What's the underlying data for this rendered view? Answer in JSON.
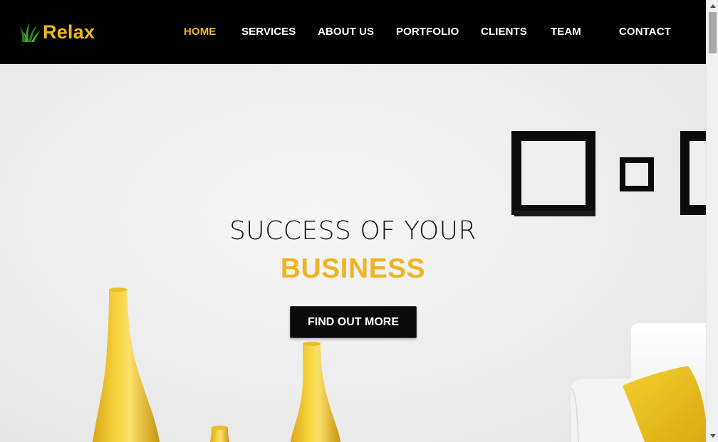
{
  "brand": {
    "name": "Relax",
    "icon": "grass-icon",
    "accent_color": "#f2b821"
  },
  "nav": {
    "items": [
      {
        "label": "HOME",
        "active": true
      },
      {
        "label": "SERVICES",
        "active": false
      },
      {
        "label": "ABOUT US",
        "active": false
      },
      {
        "label": "PORTFOLIO",
        "active": false
      },
      {
        "label": "CLIENTS",
        "active": false
      },
      {
        "label": "TEAM",
        "active": false
      },
      {
        "label": "CONTACT",
        "active": false
      }
    ]
  },
  "hero": {
    "title": "SUCCESS OF YOUR",
    "subtitle": "BUSINESS",
    "cta_label": "FIND OUT MORE",
    "highlight_color": "#f0b325"
  }
}
